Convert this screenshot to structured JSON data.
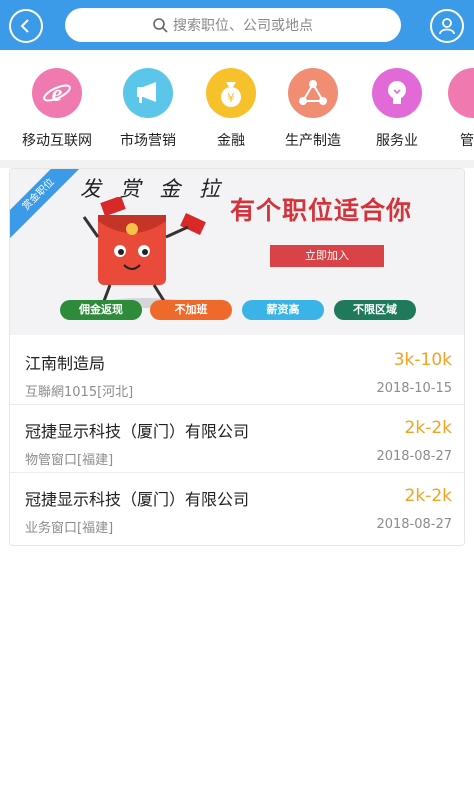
{
  "header": {
    "search_placeholder": "搜索职位、公司或地点",
    "back_icon": "chevron-left-icon",
    "user_icon": "user-icon",
    "bg_color": "#3c9be8"
  },
  "categories": [
    {
      "label": "移动互联网",
      "icon": "ie-browser-icon",
      "color": "#f07ab0"
    },
    {
      "label": "市场营销",
      "icon": "megaphone-icon",
      "color": "#5cc6ea"
    },
    {
      "label": "金融",
      "icon": "money-bag-icon",
      "color": "#f7c12c"
    },
    {
      "label": "生产制造",
      "icon": "network-icon",
      "color": "#f08d72"
    },
    {
      "label": "服务业",
      "icon": "lightbulb-icon",
      "color": "#e26ad8"
    },
    {
      "label": "管",
      "icon": "partial-icon",
      "color": "#f07ab0"
    }
  ],
  "banner": {
    "ribbon": "赏金职位",
    "calligraphy": "发 赏 金 拉",
    "slogan": "有个职位适合你",
    "cta": "立即加入",
    "tags": [
      {
        "label": "佣金返现",
        "color": "#2e8b3a"
      },
      {
        "label": "不加班",
        "color": "#ef6a2a"
      },
      {
        "label": "薪资高",
        "color": "#3ab3e8"
      },
      {
        "label": "不限区域",
        "color": "#1f7a5c"
      }
    ]
  },
  "jobs": [
    {
      "title": "江南制造局",
      "salary": "3k-10k",
      "dept": "互聯網1015[河北]",
      "date": "2018-10-15"
    },
    {
      "title": "冠捷显示科技（厦门）有限公司",
      "salary": "2k-2k",
      "dept": "物管窗口[福建]",
      "date": "2018-08-27"
    },
    {
      "title": "冠捷显示科技（厦门）有限公司",
      "salary": "2k-2k",
      "dept": "业务窗口[福建]",
      "date": "2018-08-27"
    }
  ]
}
